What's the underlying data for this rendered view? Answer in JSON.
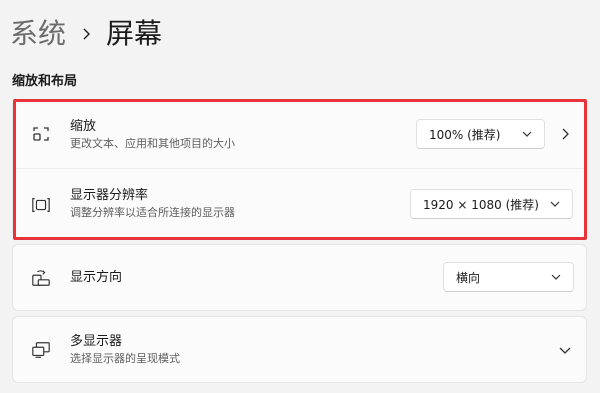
{
  "breadcrumb": {
    "parent": "系统",
    "current": "屏幕"
  },
  "section": {
    "title": "缩放和布局"
  },
  "settings": {
    "scale": {
      "icon": "scale-icon",
      "title": "缩放",
      "subtitle": "更改文本、应用和其他项目的大小",
      "value": "100% (推荐)"
    },
    "resolution": {
      "icon": "resolution-icon",
      "title": "显示器分辨率",
      "subtitle": "调整分辨率以适合所连接的显示器",
      "value": "1920 × 1080 (推荐)"
    },
    "orientation": {
      "icon": "orientation-icon",
      "title": "显示方向",
      "value": "横向"
    },
    "multi_display": {
      "icon": "multi-display-icon",
      "title": "多显示器",
      "subtitle": "选择显示器的呈现模式"
    }
  },
  "colors": {
    "highlight": "#e8333a",
    "background": "#f3f3f3",
    "card": "#fbfbfb"
  }
}
